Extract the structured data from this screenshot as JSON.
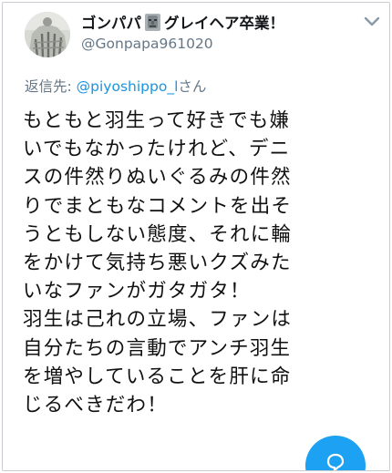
{
  "tweet": {
    "display_name": "ゴンパパ",
    "display_name_suffix": "グレイヘア卒業！",
    "emoji_icon": "moai-emoji",
    "handle": "@Gonpapa961020",
    "reply_prefix": "返信先: ",
    "reply_to": "@piyoshippo_l",
    "reply_suffix": "さん",
    "text_lines": [
      "もともと羽生って好きでも嫌",
      "いでもなかったけれど、デニ",
      "スの件然りぬいぐるみの件然",
      "りでまともなコメントを出そ",
      "うともしない態度、それに輪",
      "をかけて気持ち悪いクズみた",
      "いなファンがガタガタ！",
      "羽生は己れの立場、ファンは",
      "自分たちの言動でアンチ羽生",
      "を増やしていることを肝に命",
      "じるべきだわ！"
    ]
  },
  "icons": {
    "more_menu": "chevron-down-icon",
    "compose": "compose-reply-icon"
  },
  "colors": {
    "link": "#1b95e0",
    "secondary_text": "#657786",
    "fab": "#1da1f2"
  }
}
